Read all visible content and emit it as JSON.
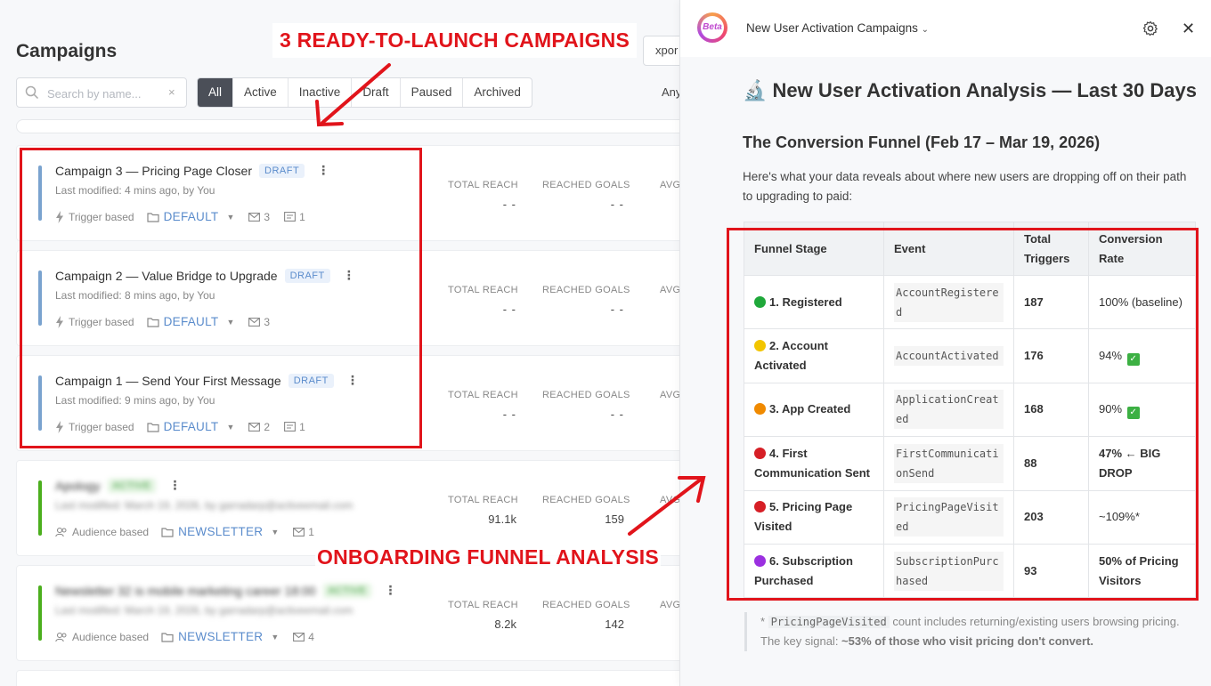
{
  "page_title": "Campaigns",
  "search": {
    "placeholder": "Search by name...",
    "clear": "×"
  },
  "filters": [
    "All",
    "Active",
    "Inactive",
    "Draft",
    "Paused",
    "Archived"
  ],
  "export_label": "xpor",
  "any_label": "Any",
  "stat_labels": {
    "reach": "TOTAL REACH",
    "goals": "REACHED GOALS",
    "avg": "AVG"
  },
  "campaigns": [
    {
      "name": "Campaign 3 — Pricing Page Closer",
      "badge": "DRAFT",
      "modified": "Last modified: 4 mins ago, by You",
      "trigger": "Trigger based",
      "folder": "DEFAULT",
      "emails": "3",
      "docs": "1",
      "reach": "- -",
      "goals": "- -"
    },
    {
      "name": "Campaign 2 — Value Bridge to Upgrade",
      "badge": "DRAFT",
      "modified": "Last modified: 8 mins ago, by You",
      "trigger": "Trigger based",
      "folder": "DEFAULT",
      "emails": "3",
      "reach": "- -",
      "goals": "- -"
    },
    {
      "name": "Campaign 1 — Send Your First Message",
      "badge": "DRAFT",
      "modified": "Last modified: 9 mins ago, by You",
      "trigger": "Trigger based",
      "folder": "DEFAULT",
      "emails": "2",
      "docs": "1",
      "reach": "- -",
      "goals": "- -"
    },
    {
      "name": "Apology",
      "badge": "ACTIVE",
      "modified": "Last modified: March 19, 2026, by garradarp@activeemail.com",
      "trigger": "Audience based",
      "folder": "NEWSLETTER",
      "emails": "1",
      "reach": "91.1k",
      "goals": "159"
    },
    {
      "name": "Newsletter 32 is mobile marketing career 18:00",
      "badge": "ACTIVE",
      "modified": "Last modified: March 19, 2026, by garradarp@activeemail.com",
      "trigger": "Audience based",
      "folder": "NEWSLETTER",
      "emails": "4",
      "reach": "8.2k",
      "goals": "142"
    }
  ],
  "annotations": {
    "top": "3 READY-TO-LAUNCH CAMPAIGNS",
    "bottom": "ONBOARDING FUNNEL ANALYSIS"
  },
  "panel": {
    "logo_text": "Beta",
    "conversation_title": "New User Activation Campaigns",
    "h1": "🔬 New User Activation Analysis — Last 30 Days",
    "h2": "The Conversion Funnel (Feb 17 – Mar 19, 2026)",
    "intro": "Here's what your data reveals about where new users are dropping off on their path to upgrading to paid:",
    "table_headers": [
      "Funnel Stage",
      "Event",
      "Total Triggers",
      "Conversion Rate"
    ],
    "rows": [
      {
        "dot": "#1fa83a",
        "stage": "1. Registered",
        "event": "AccountRegistered",
        "total": "187",
        "rate": "100% (baseline)",
        "bold": false,
        "check": false
      },
      {
        "dot": "#f2c500",
        "stage": "2. Account Activated",
        "event": "AccountActivated",
        "total": "176",
        "rate": "94%",
        "bold": false,
        "check": true
      },
      {
        "dot": "#f08a00",
        "stage": "3. App Created",
        "event": "ApplicationCreated",
        "total": "168",
        "rate": "90%",
        "bold": false,
        "check": true
      },
      {
        "dot": "#d61f26",
        "stage": "4. First Communication Sent",
        "event": "FirstCommunicationSend",
        "total": "88",
        "rate": "47% ← BIG DROP",
        "bold": true,
        "check": false
      },
      {
        "dot": "#d61f26",
        "stage": "5. Pricing Page Visited",
        "event": "PricingPageVisited",
        "total": "203",
        "rate": "~109%*",
        "bold": false,
        "check": false
      },
      {
        "dot": "#9b30e0",
        "stage": "6. Subscription Purchased",
        "event": "SubscriptionPurchased",
        "total": "93",
        "rate": "50% of Pricing Visitors",
        "bold": true,
        "check": false
      }
    ],
    "note_prefix": "* ",
    "note_code": "PricingPageVisited",
    "note_mid": " count includes returning/existing users browsing pricing. The key signal: ",
    "note_bold": "~53% of those who visit pricing don't convert."
  },
  "colors": {
    "accent_blue": "#7aa3cf",
    "accent_green": "#4caf1e",
    "annotation_red": "#e1141b",
    "filter_active": "#4b4f58"
  },
  "icons": [
    "search-icon",
    "clear-icon",
    "kebab-icon",
    "bolt-icon",
    "users-icon",
    "folder-icon",
    "envelope-icon",
    "document-icon",
    "chevron-down-icon",
    "gear-icon",
    "close-icon",
    "check-icon"
  ]
}
